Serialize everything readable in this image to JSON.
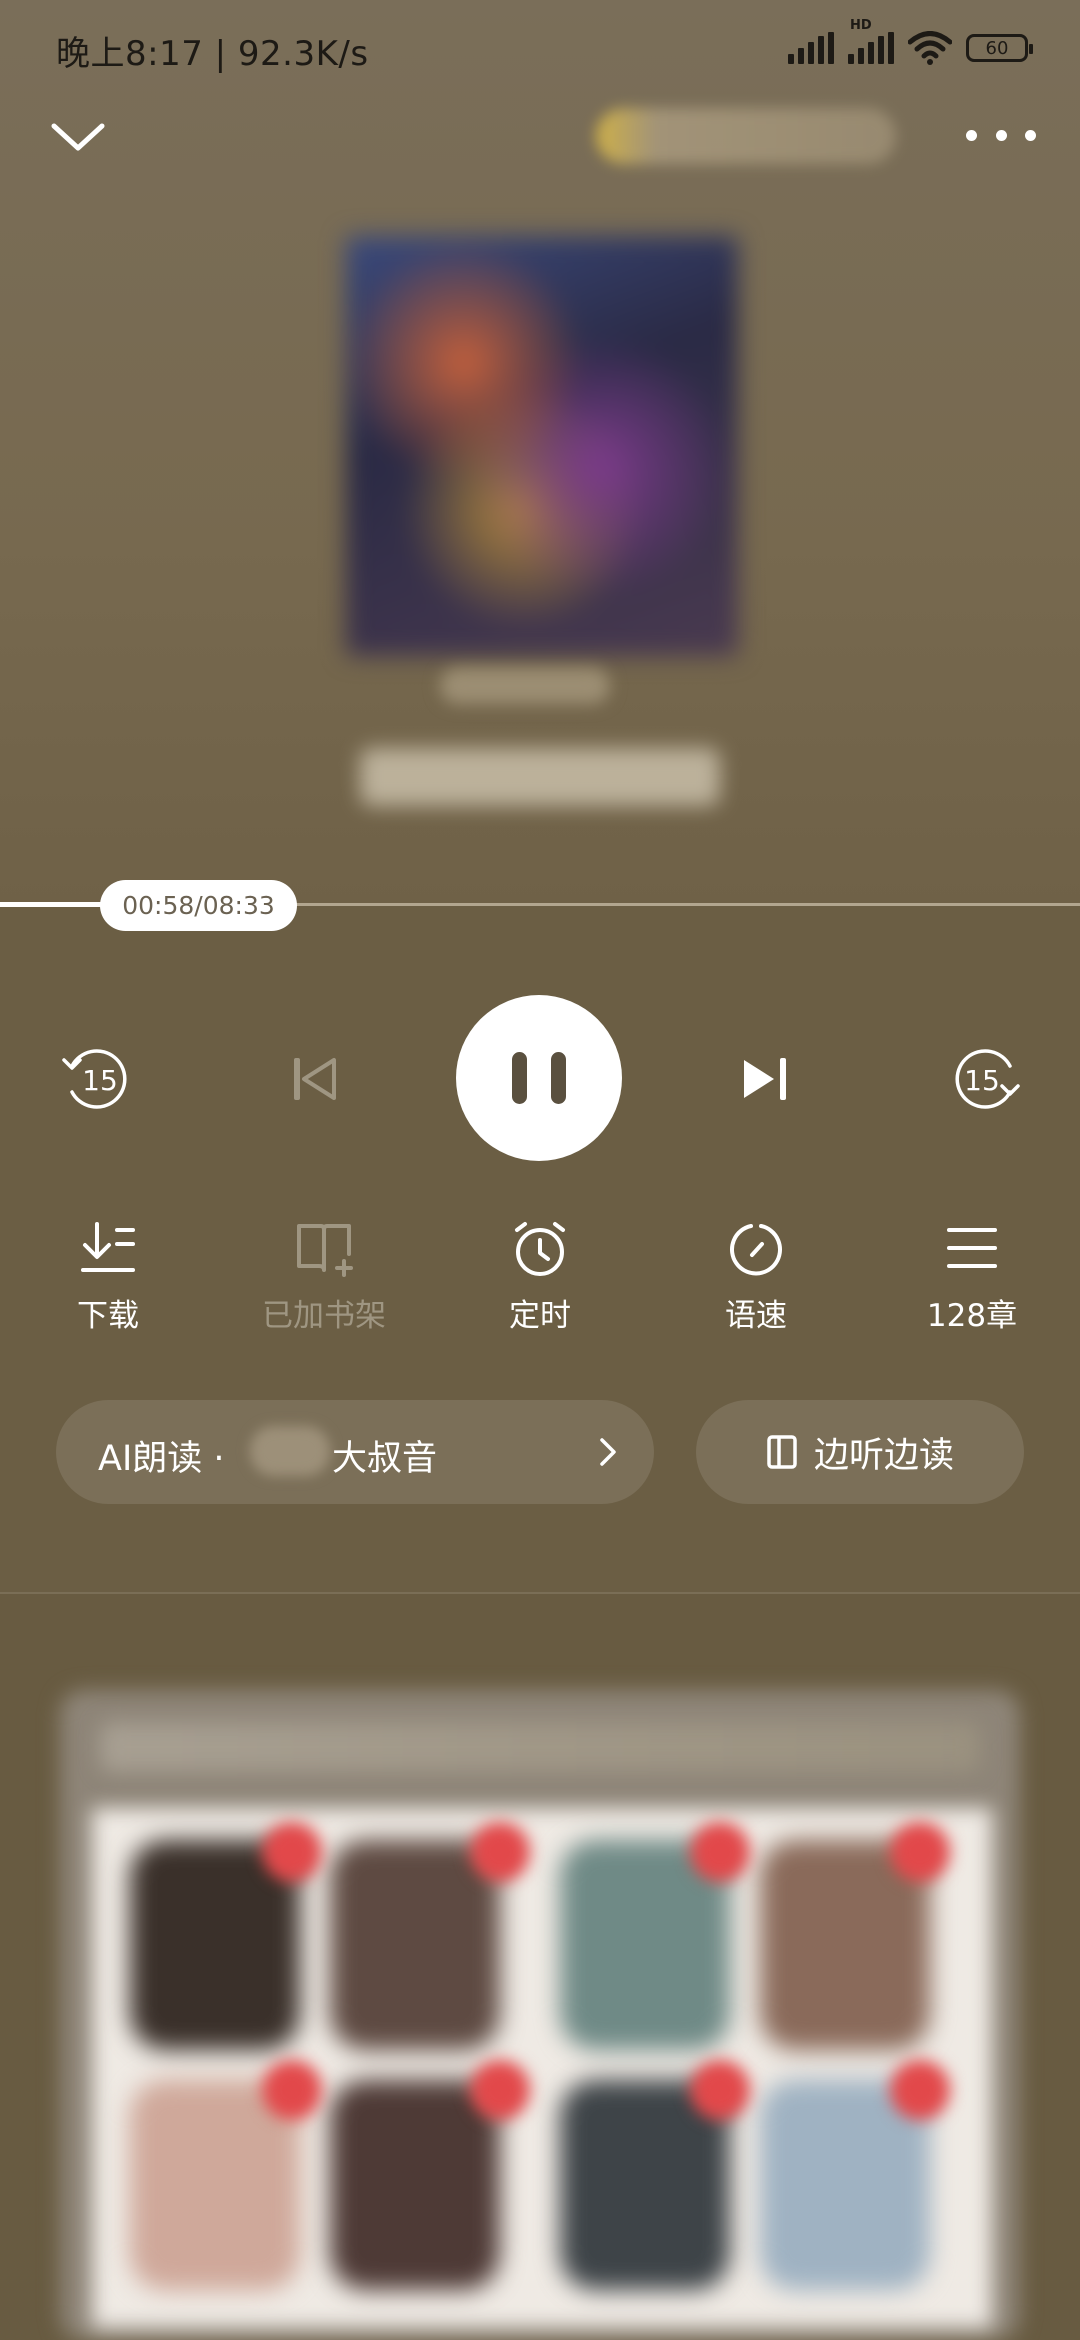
{
  "status_bar": {
    "time": "晚上8:17 | 92.3K/s",
    "hd_label": "HD",
    "battery": "60",
    "icons": [
      "signal-icon",
      "hd-signal-icon",
      "wifi-icon",
      "battery-icon"
    ]
  },
  "player": {
    "progress": {
      "elapsed": "00:58",
      "total": "08:33",
      "label": "00:58/08:33",
      "fraction": 0.113
    },
    "rewind": {
      "icon": "rewind-15-icon",
      "label": "15"
    },
    "forward": {
      "icon": "forward-15-icon",
      "label": "15"
    }
  },
  "functions": [
    {
      "id": "download",
      "label": "下载",
      "icon": "download-list-icon",
      "enabled": true
    },
    {
      "id": "bookshelf",
      "label": "已加书架",
      "icon": "bookshelf-added-icon",
      "enabled": false
    },
    {
      "id": "timer",
      "label": "定时",
      "icon": "alarm-clock-icon",
      "enabled": true
    },
    {
      "id": "speed",
      "label": "语速",
      "icon": "speed-dial-icon",
      "enabled": true
    },
    {
      "id": "chapters",
      "label": "128章",
      "icon": "menu-list-icon",
      "enabled": true
    }
  ],
  "ai_read": {
    "prefix": "AI朗读 · ",
    "voice": "大叔音"
  },
  "listen_read": {
    "label": "边听边读"
  },
  "colors": {
    "background": "#6b5e44",
    "button_bg": "#7b6f58",
    "white": "#ffffff"
  }
}
